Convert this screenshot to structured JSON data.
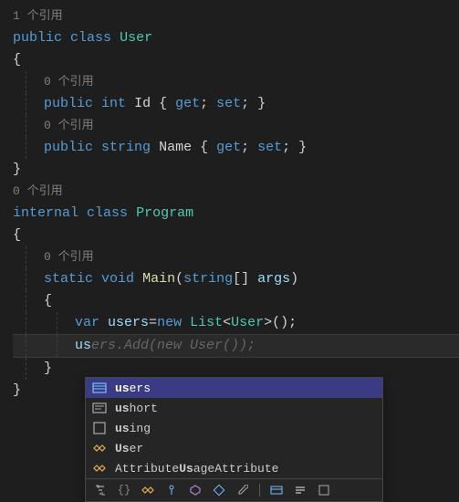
{
  "refs": {
    "user_class": "1 个引用",
    "id_prop": "0 个引用",
    "name_prop": "0 个引用",
    "program_class": "0 个引用",
    "main_method": "0 个引用"
  },
  "code": {
    "public": "public",
    "internal": "internal",
    "class": "class",
    "int": "int",
    "string": "string",
    "static": "static",
    "void": "void",
    "var": "var",
    "new": "new",
    "get": "get",
    "set": "set",
    "user": "User",
    "program": "Program",
    "id": "Id",
    "name": "Name",
    "main": "Main",
    "args": "args",
    "users": "users",
    "list": "List",
    "typed_prefix": "us",
    "ghost_suffix": "ers.Add(new User());"
  },
  "intellisense": {
    "items": [
      {
        "label_pre": "",
        "match": "us",
        "label_post": "ers",
        "kind": "local"
      },
      {
        "label_pre": "",
        "match": "us",
        "label_post": "hort",
        "kind": "keyword"
      },
      {
        "label_pre": "",
        "match": "us",
        "label_post": "ing",
        "kind": "keyword"
      },
      {
        "label_pre": "",
        "match": "Us",
        "label_post": "er",
        "kind": "class"
      },
      {
        "label_pre": "Attribute",
        "match": "Us",
        "label_post": "ageAttribute",
        "kind": "class"
      }
    ]
  }
}
